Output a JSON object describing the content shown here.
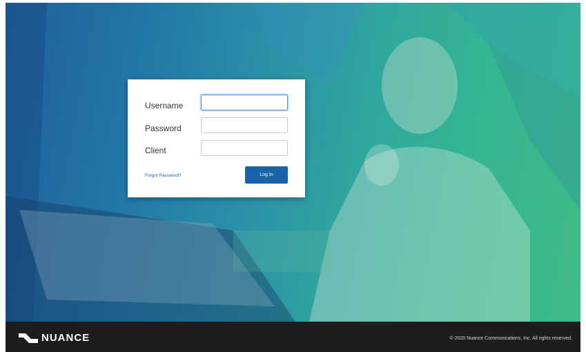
{
  "login": {
    "username_label": "Username",
    "username_value": "",
    "password_label": "Password",
    "password_value": "",
    "client_label": "Client",
    "client_value": "",
    "forgot_link": "Forgot Password?",
    "login_button": "Log In"
  },
  "footer": {
    "logo_text": "NUANCE",
    "copyright": "© 2020 Nuance Communications, Inc. All rights reserved."
  },
  "colors": {
    "brand_blue": "#1b63a8",
    "footer_bg": "#1d1d1f"
  }
}
